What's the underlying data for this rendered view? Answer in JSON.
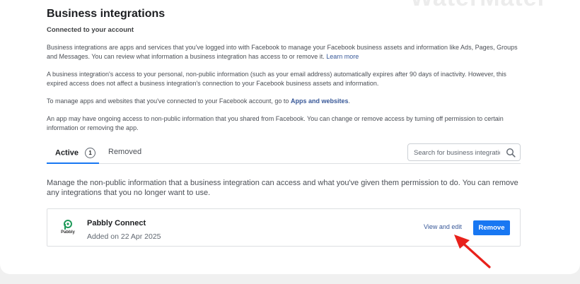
{
  "watermark": "WaterMater",
  "header": {
    "title": "Business integrations",
    "subtitle": "Connected to your account"
  },
  "intro": {
    "p1_text": "Business integrations are apps and services that you've logged into with Facebook to manage your Facebook business assets and information like Ads, Pages, Groups and Messages. You can review what information a business integration has access to or remove it.",
    "p1_link": "Learn more",
    "p2_text": "A business integration's access to your personal, non-public information (such as your email address) automatically expires after 90 days of inactivity. However, this expired access does not affect a business integration's connection to your Facebook business assets and information.",
    "p3_text": "To manage apps and websites that you've connected to your Facebook account, go to",
    "p3_link": "Apps and websites",
    "p4_text": "An app may have ongoing access to non-public information that you shared from Facebook. You can change or remove access by turning off permission to certain information or removing the app."
  },
  "tabs": {
    "active_label": "Active",
    "active_count": "1",
    "removed_label": "Removed"
  },
  "search": {
    "placeholder": "Search for business integrations"
  },
  "manage_text": "Manage the non-public information that a business integration can access and what you've given them permission to do. You can remove any integrations that you no longer want to use.",
  "integration": {
    "logo_text": "Pabbly",
    "name": "Pabbly Connect",
    "added": "Added on 22 Apr 2025",
    "view_edit_label": "View and edit",
    "remove_label": "Remove"
  },
  "colors": {
    "accent": "#1877f2",
    "link": "#385898",
    "pabbly_green": "#1f9a5a",
    "arrow_red": "#e8211b"
  }
}
